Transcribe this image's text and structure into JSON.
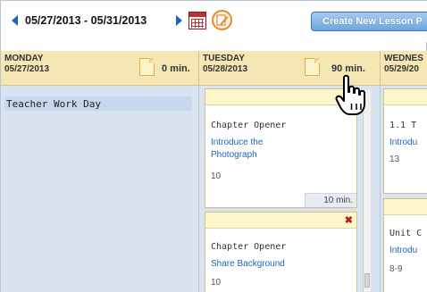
{
  "toolbar": {
    "date_range": "05/27/2013 - 05/31/2013",
    "create_button_label": "Create New Lesson P"
  },
  "columns": [
    {
      "day": "MONDAY",
      "date": "05/27/2013",
      "minutes": "0 min."
    },
    {
      "day": "TUESDAY",
      "date": "05/28/2013",
      "minutes": "90 min."
    },
    {
      "day": "WEDNES",
      "date": "05/29/20",
      "minutes": ""
    }
  ],
  "monday": {
    "event": "Teacher Work Day"
  },
  "tuesday_cards": [
    {
      "title": "Chapter Opener",
      "link_line1": "Introduce the",
      "link_line2": "Photograph",
      "pages": "10",
      "duration": "10 min."
    },
    {
      "title": "Chapter Opener",
      "link_line1": "Share Background",
      "link_line2": "",
      "pages": "10",
      "duration": ""
    }
  ],
  "wednesday_cards": [
    {
      "title": "1.1 T",
      "link": "Introdu",
      "pages": "13"
    },
    {
      "title": "Unit C",
      "link": "Introdu",
      "pages": "8-9"
    }
  ],
  "icons": {
    "prev": "triangle-left-icon",
    "next": "triangle-right-icon",
    "calendar": "calendar-icon",
    "edit": "pencil-circle-icon",
    "note": "note-icon",
    "delete": "close-icon",
    "cursor": "hand-pointer-icon"
  },
  "colors": {
    "header_bg": "#f5e6b3",
    "body_bg": "#d9e4f0",
    "link": "#1d63c2",
    "button": "#6ea5de",
    "delete": "#b71c1c"
  }
}
